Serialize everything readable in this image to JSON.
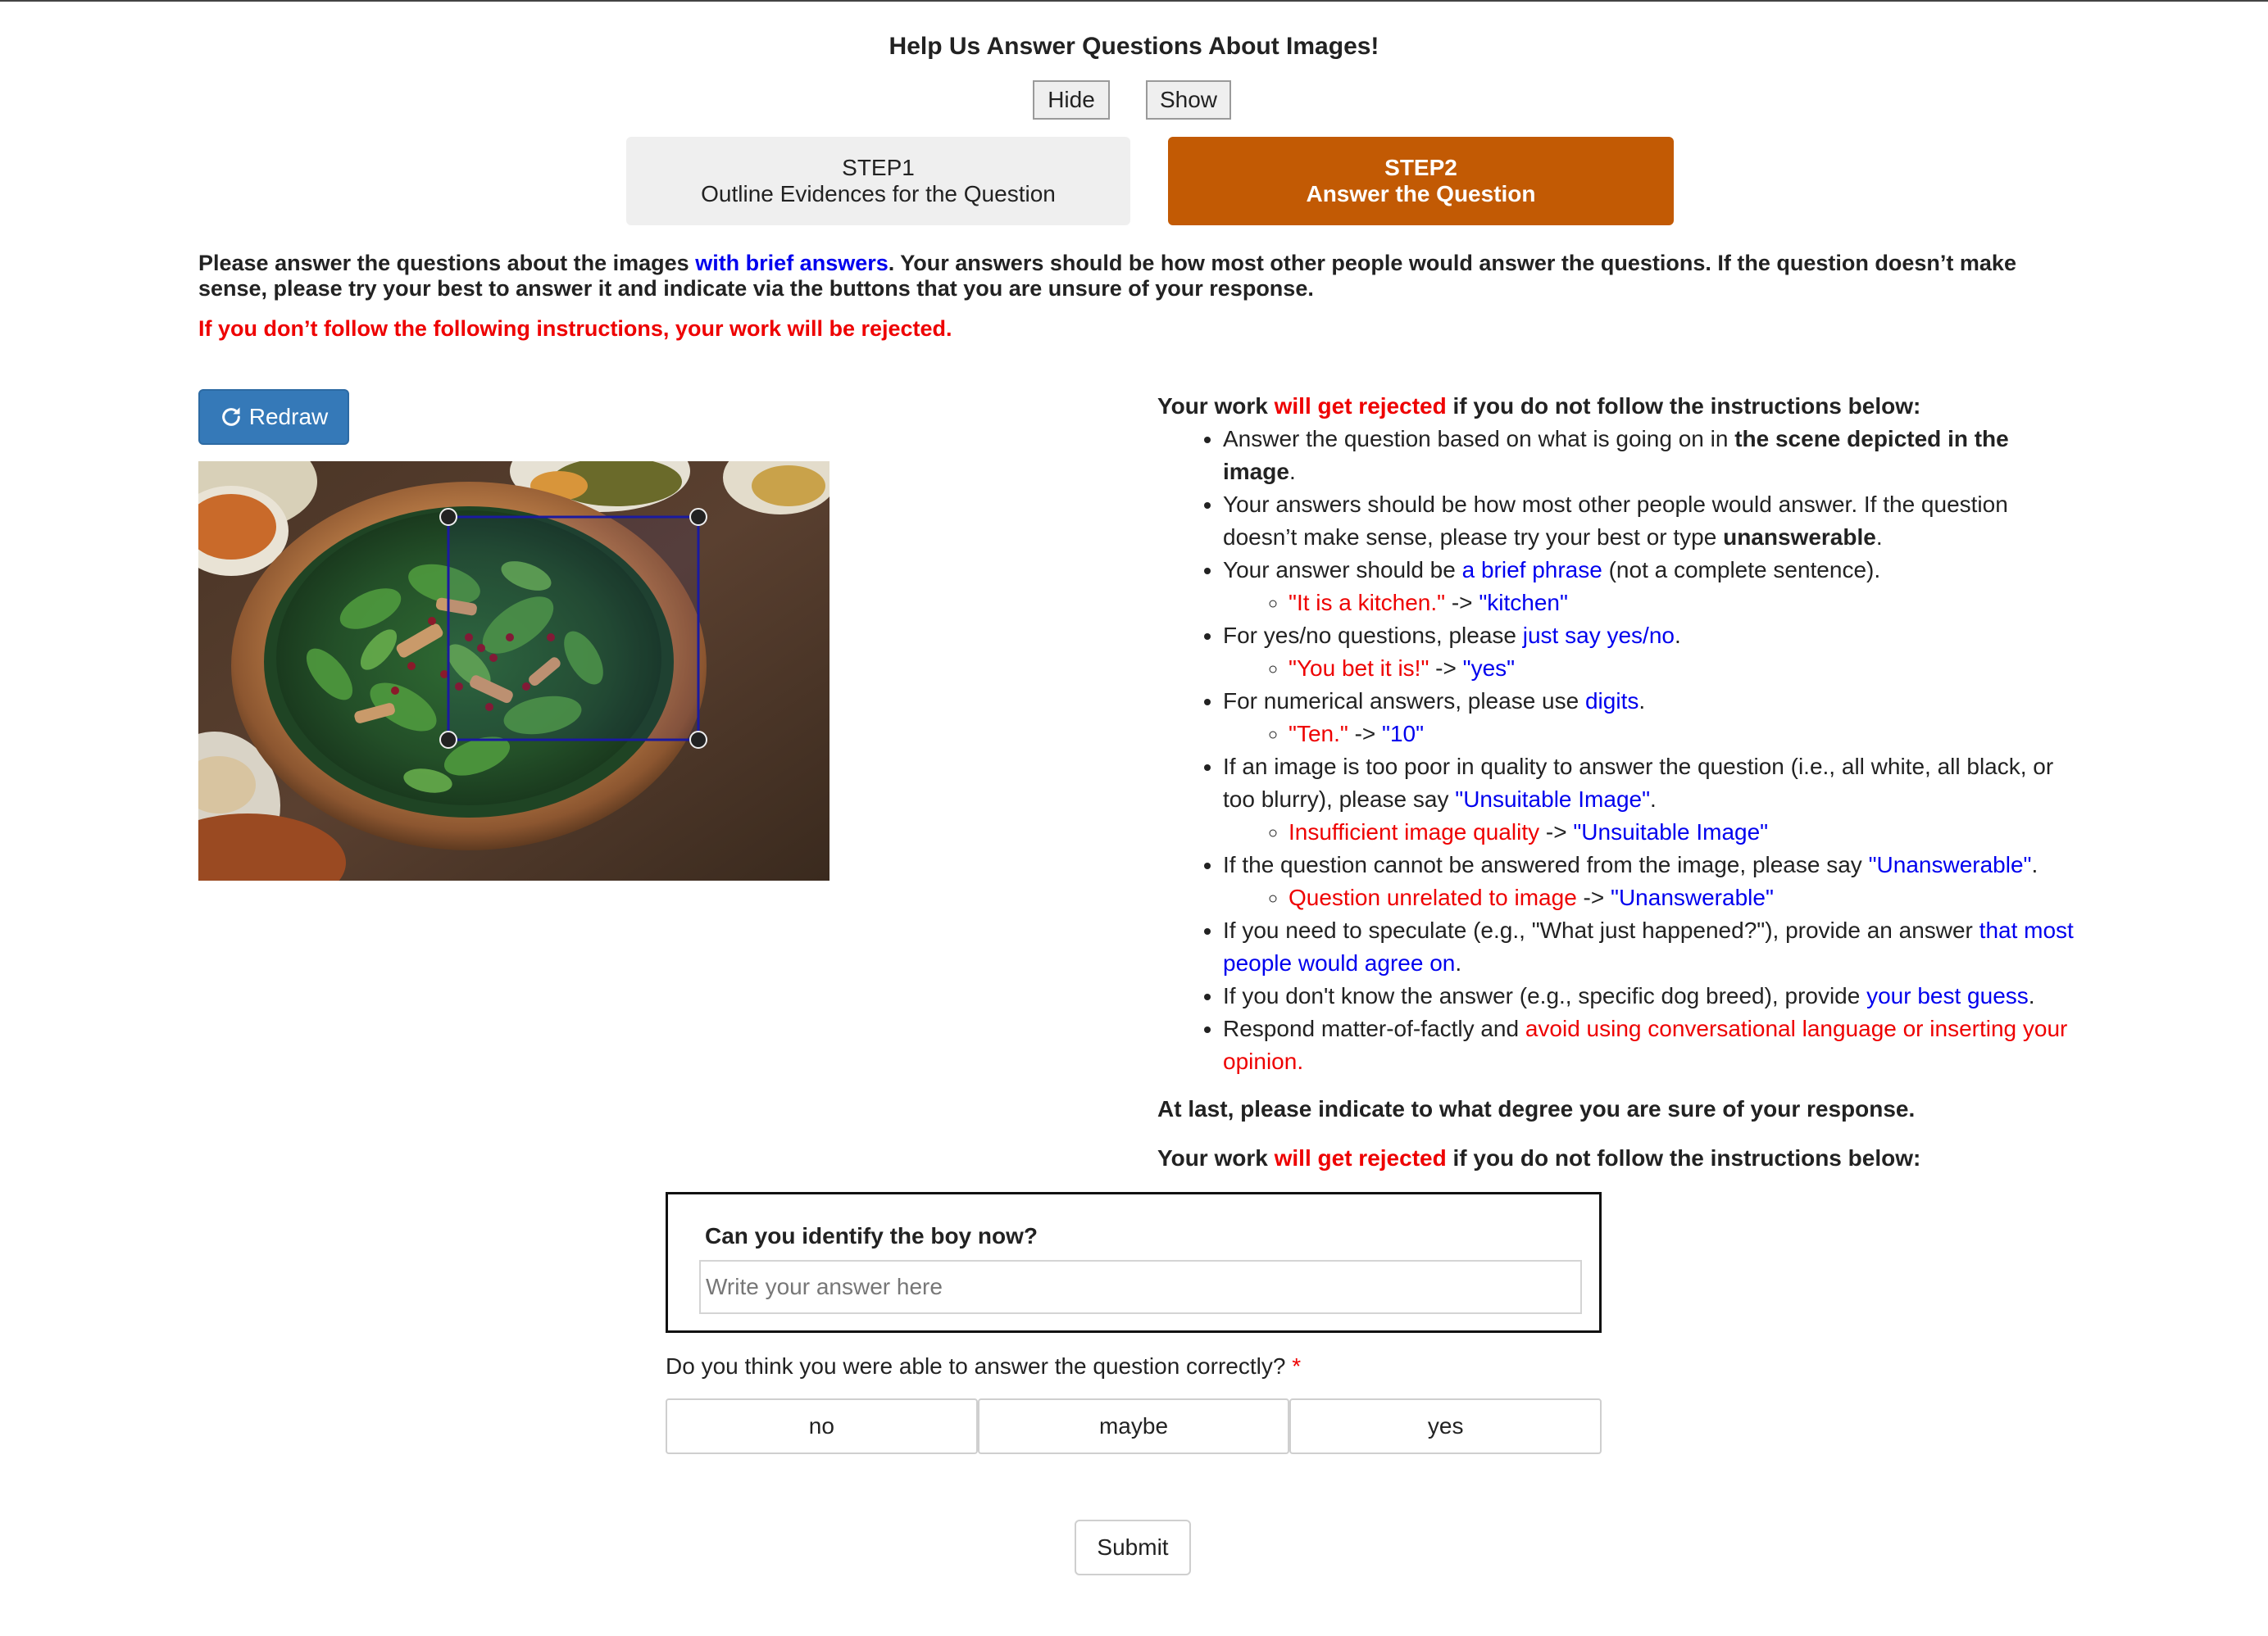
{
  "page": {
    "title": "Help Us Answer Questions About Images!",
    "hide_label": "Hide",
    "show_label": "Show"
  },
  "steps": [
    {
      "num": "STEP1",
      "label": "Outline Evidences for the Question",
      "active": false
    },
    {
      "num": "STEP2",
      "label": "Answer the Question",
      "active": true
    }
  ],
  "intro": {
    "part1": "Please answer the questions about the images ",
    "highlight": "with brief answers",
    "part2": ". Your answers should be how most other people would answer the questions. If the question doesn’t make sense, please try your best to answer it and indicate via the buttons that you are unsure of your response.",
    "warning": "If you don’t follow the following instructions, your work will be rejected."
  },
  "redraw_label": "Redraw",
  "image": {
    "alt": "wooden bowl of spinach salad",
    "bbox_handles": 4
  },
  "instructions": {
    "head1": "Your work ",
    "head_red": "will get rejected",
    "head2": " if you do not follow the instructions below:",
    "b1a": "Answer the question based on what is going on in ",
    "b1b": "the scene depicted in the image",
    "b1c": ".",
    "b2a": "Your answers should be how most other people would answer. If the question doesn’t make sense, please try your best or type ",
    "b2b": "unanswerable",
    "b2c": ".",
    "b3a": "Your answer should be ",
    "b3b": "a brief phrase",
    "b3c": " (not a complete sentence).",
    "b3s_red": "\"It is a kitchen.\"",
    "b3s_arrow": " -> ",
    "b3s_blue": "\"kitchen\"",
    "b4a": "For yes/no questions, please ",
    "b4b": "just say yes/no",
    "b4c": ".",
    "b4s_red": "\"You bet it is!\"",
    "b4s_arrow": " -> ",
    "b4s_blue": "\"yes\"",
    "b5a": "For numerical answers, please use ",
    "b5b": "digits",
    "b5c": ".",
    "b5s_red": "\"Ten.\"",
    "b5s_arrow": " -> ",
    "b5s_blue": "\"10\"",
    "b6a": "If an image is too poor in quality to answer the question (i.e., all white, all black, or too blurry), please say ",
    "b6b": "\"Unsuitable Image\"",
    "b6c": ".",
    "b6s_red": "Insufficient image quality",
    "b6s_arrow": " -> ",
    "b6s_blue": "\"Unsuitable Image\"",
    "b7a": "If the question cannot be answered from the image, please say ",
    "b7b": "\"Unanswerable\"",
    "b7c": ".",
    "b7s_red": "Question unrelated to image",
    "b7s_arrow": " -> ",
    "b7s_blue": "\"Unanswerable\"",
    "b8a": "If you need to speculate (e.g., \"What just happened?\"), provide an answer ",
    "b8b": "that most people would agree on",
    "b8c": ".",
    "b9a": "If you don't know the answer (e.g., specific dog breed), provide ",
    "b9b": "your best guess",
    "b9c": ".",
    "b10a": "Respond matter-of-factly and ",
    "b10b": "avoid using conversational language or inserting your opinion",
    "b10c": ".",
    "at_last": "At last, please indicate to what degree you are sure of your response."
  },
  "question": {
    "text": "Can you identify the boy now?",
    "answer_value": "",
    "answer_placeholder": "Write your answer here"
  },
  "confidence": {
    "prompt": "Do you think you were able to answer the question correctly?",
    "required_mark": "*",
    "options": [
      "no",
      "maybe",
      "yes"
    ]
  },
  "submit_label": "Submit",
  "colors": {
    "accent": "#c25a04",
    "primary_button": "#3579b8",
    "link_blue": "#0000ee",
    "warning_red": "#ee0000"
  }
}
